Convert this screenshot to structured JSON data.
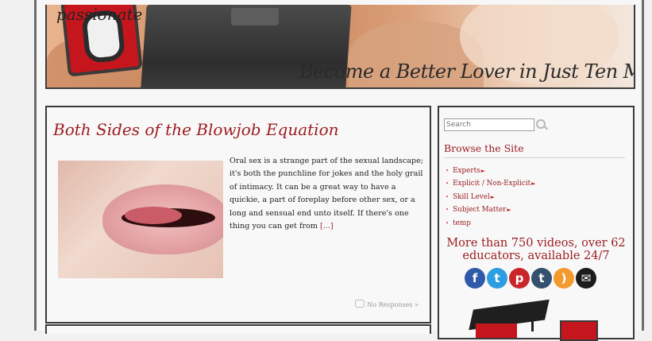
{
  "header": {
    "logo_text": "passionate",
    "tagline": "Become a Better Lover in Just Ten Minutes a Day"
  },
  "post": {
    "title": "Both Sides of the Blowjob Equation",
    "excerpt": "Oral sex is a strange part of the sexual landscape; it's both the punchline for jokes and the holy grail of intimacy. It can be a great way to have a quickie, a part of foreplay before other sex, or a long and sensual end unto itself. If there's one thing you can get from",
    "read_more": "[...]",
    "comments": "No Responses »"
  },
  "sidebar": {
    "search_placeholder": "Search",
    "heading": "Browse the Site",
    "nav_items": [
      {
        "label": "Experts",
        "has_submenu": true
      },
      {
        "label": "Explicit / Non-Explicit",
        "has_submenu": true
      },
      {
        "label": "Skill Level",
        "has_submenu": true
      },
      {
        "label": "Subject Matter",
        "has_submenu": true
      },
      {
        "label": "temp",
        "has_submenu": false
      }
    ],
    "promo": "More than 750 videos, over 62 educators, available 24/7",
    "social": [
      {
        "name": "facebook-icon",
        "glyph": "f",
        "color": "#2f5aa8"
      },
      {
        "name": "twitter-icon",
        "glyph": "t",
        "color": "#2c9de0"
      },
      {
        "name": "pinterest-icon",
        "glyph": "p",
        "color": "#c9262c"
      },
      {
        "name": "tumblr-icon",
        "glyph": "t",
        "color": "#34506e"
      },
      {
        "name": "rss-icon",
        "glyph": ")",
        "color": "#f39a2e"
      },
      {
        "name": "email-icon",
        "glyph": "✉",
        "color": "#1c1c1c"
      }
    ]
  },
  "colors": {
    "accent": "#9b1e22",
    "brand_red": "#c5161d",
    "border": "#3a3a3a"
  }
}
